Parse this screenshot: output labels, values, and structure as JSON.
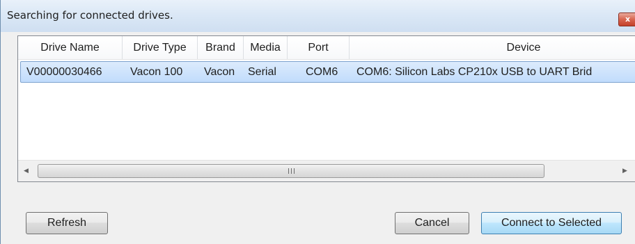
{
  "window": {
    "title": "Searching for connected drives.",
    "close_glyph": "x"
  },
  "table": {
    "columns": [
      "Drive Name",
      "Drive Type",
      "Brand",
      "Media",
      "Port",
      "Device"
    ],
    "rows": [
      {
        "drive_name": "V00000030466",
        "drive_type": "Vacon 100",
        "brand": "Vacon",
        "media": "Serial",
        "port": "COM6",
        "device": "COM6: Silicon Labs CP210x USB to UART Brid"
      }
    ],
    "scrollbar": {
      "left_arrow": "◀",
      "right_arrow": "▶"
    }
  },
  "buttons": {
    "refresh": "Refresh",
    "cancel": "Cancel",
    "connect": "Connect to Selected"
  },
  "colors": {
    "selection": "#c1dcfc",
    "selection_border": "#7da2ce",
    "close_button": "#c4402a",
    "default_button_border": "#3c7fb1"
  }
}
